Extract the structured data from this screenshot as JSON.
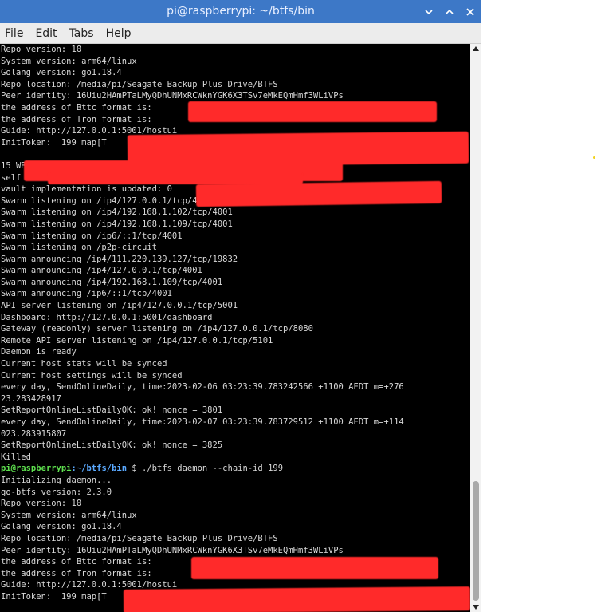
{
  "window": {
    "title": "pi@raspberrypi: ~/btfs/bin",
    "buttons": {
      "minimize": "⌄",
      "maximize": "˄",
      "close": "✕"
    }
  },
  "menu": [
    "File",
    "Edit",
    "Tabs",
    "Help"
  ],
  "terminal": {
    "lines": [
      "Repo version: 10",
      "System version: arm64/linux",
      "Golang version: go1.18.4",
      "Repo location: /media/pi/Seagate Backup Plus Drive/BTFS",
      "Peer identity: 16Uiu2HAmPTaLMyQDhUNMxRCWknYGK6X3TSv7eMkEQmHmf3WLiVPs",
      "the address of Bttc format is:",
      "the address of Tron format is:",
      "Guide: http://127.0.0.1:5001/hostui",
      "InitToken:  199 map[T",
      "",
      "15 WBTT:0",
      "self vault: 0",
      "vault implementation is updated: 0",
      "Swarm listening on /ip4/127.0.0.1/tcp/4001",
      "Swarm listening on /ip4/192.168.1.102/tcp/4001",
      "Swarm listening on /ip4/192.168.1.109/tcp/4001",
      "Swarm listening on /ip6/::1/tcp/4001",
      "Swarm listening on /p2p-circuit",
      "Swarm announcing /ip4/111.220.139.127/tcp/19832",
      "Swarm announcing /ip4/127.0.0.1/tcp/4001",
      "Swarm announcing /ip4/192.168.1.109/tcp/4001",
      "Swarm announcing /ip6/::1/tcp/4001",
      "API server listening on /ip4/127.0.0.1/tcp/5001",
      "Dashboard: http://127.0.0.1:5001/dashboard",
      "Gateway (readonly) server listening on /ip4/127.0.0.1/tcp/8080",
      "Remote API server listening on /ip4/127.0.0.1/tcp/5101",
      "Daemon is ready",
      "Current host stats will be synced",
      "Current host settings will be synced",
      "every day, SendOnlineDaily, time:2023-02-06 03:23:39.783242566 +1100 AEDT m=+276",
      "23.283428917",
      "SetReportOnlineListDailyOK: ok! nonce = 3801",
      "every day, SendOnlineDaily, time:2023-02-07 03:23:39.783729512 +1100 AEDT m=+114",
      "023.283915807",
      "SetReportOnlineListDailyOK: ok! nonce = 3825",
      "Killed"
    ],
    "prompt": {
      "user": "pi@raspberrypi",
      "sep": ":",
      "path": "~/btfs/bin",
      "dollar": " $ ",
      "command": "./btfs daemon --chain-id 199"
    },
    "lines_after": [
      "Initializing daemon...",
      "go-btfs version: 2.3.0",
      "Repo version: 10",
      "System version: arm64/linux",
      "Golang version: go1.18.4",
      "Repo location: /media/pi/Seagate Backup Plus Drive/BTFS",
      "Peer identity: 16Uiu2HAmPTaLMyQDhUNMxRCWknYGK6X3TSv7eMkEQmHmf3WLiVPs",
      "the address of Bttc format is:",
      "the address of Tron format is:",
      "Guide: http://127.0.0.1:5001/hostui",
      "InitToken:  199 map[T"
    ]
  },
  "colors": {
    "titlebar": "#3d78c7",
    "terminal_bg": "#000000",
    "terminal_fg": "#d8d8d8",
    "prompt_user": "#5ee04e",
    "prompt_path": "#5aa9ff",
    "redaction": "#ff2a2a"
  }
}
